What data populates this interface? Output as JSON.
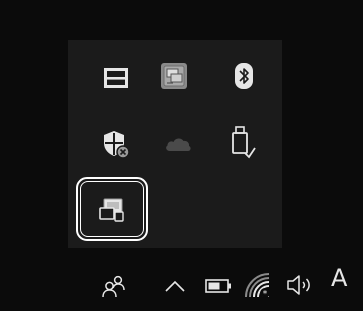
{
  "tray": {
    "icons": [
      {
        "name": "tablet-mode-icon"
      },
      {
        "name": "display-settings-app-icon"
      },
      {
        "name": "bluetooth-icon"
      },
      {
        "name": "windows-security-warning-icon"
      },
      {
        "name": "onedrive-cloud-icon"
      },
      {
        "name": "usb-safely-remove-icon"
      },
      {
        "name": "remote-display-icon"
      }
    ]
  },
  "taskbar": {
    "language_label": "A",
    "icons": [
      {
        "name": "people-icon"
      },
      {
        "name": "show-hidden-icons-chevron-icon"
      },
      {
        "name": "battery-icon"
      },
      {
        "name": "wifi-icon"
      },
      {
        "name": "volume-icon"
      }
    ]
  },
  "colors": {
    "background": "#0b0b0b",
    "flyout": "#1b1b1b",
    "icon": "#e6e6e6",
    "focus_ring": "#ffffff"
  }
}
